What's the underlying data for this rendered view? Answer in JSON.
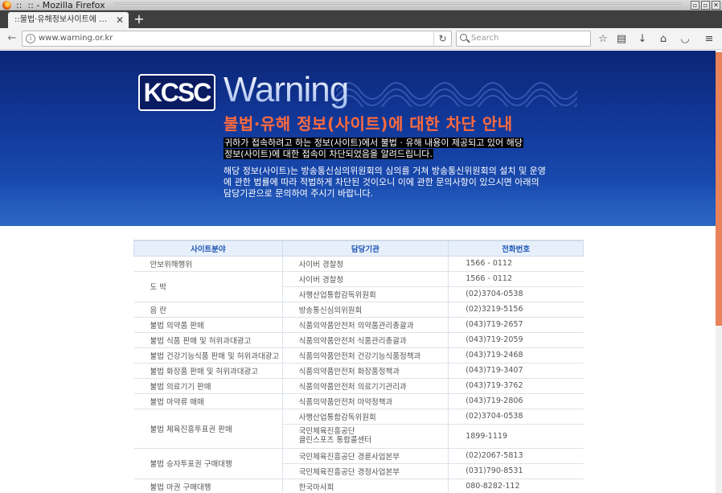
{
  "window": {
    "title": "::  :: - Mozilla Firefox",
    "buttons": [
      "▫",
      "▫",
      "✕"
    ]
  },
  "tab": {
    "title": "::불법·유해정보사이트에 대한…",
    "close": "✕",
    "new_tab": "+"
  },
  "navbar": {
    "back": "←",
    "info": "i",
    "url": "www.warning.or.kr",
    "reload": "↻",
    "search_placeholder": "Search",
    "tools": {
      "bookmark": "☆",
      "reader": "▤",
      "download": "↓",
      "home": "⌂",
      "pocket": "◡",
      "menu": "≡"
    }
  },
  "banner": {
    "logo": "KCSC",
    "wordmark": "Warning",
    "headline": "불법·유해 정보(사이트)에 대한 차단 안내",
    "para1_line1": "귀하가 접속하려고 하는 정보(사이트)에서 불법 · 유해 내용이 제공되고 있어 해당",
    "para1_line2": "정보(사이트)에 대한 접속이 차단되었음을 알려드립니다.",
    "para2": "해당 정보(사이트)는 방송통신심의위원회의 심의를 거쳐 방송통신위원회의 설치 및 운영에 관한 법률에 따라 적법하게 차단된 것이오니 이에 관한 문의사항이 있으시면 아래의 담당기관으로  문의하여 주시기 바랍니다."
  },
  "table": {
    "headers": [
      "사이트분야",
      "담당기관",
      "전화번호"
    ],
    "rows": [
      {
        "field": "안보위해행위",
        "agency": "사이버 경찰청",
        "phone": "1566 - 0112"
      },
      {
        "field": "도 박",
        "agency": "사이버 경찰청",
        "phone": "1566 - 0112"
      },
      {
        "field": "",
        "agency": "사행산업통합감독위원회",
        "phone": "(02)3704-0538"
      },
      {
        "field": "음 란",
        "agency": "방송통신심의위원회",
        "phone": "(02)3219-5156"
      },
      {
        "field": "불법 의약품 판매",
        "agency": "식품의약품안전처 의약품관리총괄과",
        "phone": "(043)719-2657"
      },
      {
        "field": "불법 식품 판매 및 허위과대광고",
        "agency": "식품의약품안전처 식품관리총괄과",
        "phone": "(043)719-2059"
      },
      {
        "field": "불법 건강기능식품 판매 및 허위과대광고",
        "agency": "식품의약품안전처 건강기능식품정책과",
        "phone": "(043)719-2468"
      },
      {
        "field": "불법 화장품 판매 및 허위과대광고",
        "agency": "식품의약품안전처 화장품정책과",
        "phone": "(043)719-3407"
      },
      {
        "field": "불법 의료기기 판매",
        "agency": "식품의약품안전처 의료기기관리과",
        "phone": "(043)719-3762"
      },
      {
        "field": "불법 마약류 매매",
        "agency": "식품의약품안전처 마약정책과",
        "phone": "(043)719-2806"
      },
      {
        "field": "불법 체육진흥투표권 판매",
        "agency": "사행산업통합감독위원회",
        "phone": "(02)3704-0538"
      },
      {
        "field": "",
        "agency_line1": "국민체육진흥공단",
        "agency_line2": "클린스포츠 통합콜센터",
        "phone": "1899-1119"
      },
      {
        "field": "불법 승자투표권 구매대행",
        "agency": "국민체육진흥공단 경륜사업본부",
        "phone": "(02)2067-5813"
      },
      {
        "field": "",
        "agency": "국민체육진흥공단 경정사업본부",
        "phone": "(031)790-8531"
      },
      {
        "field": "불법 마권 구매대행",
        "agency": "한국마사회",
        "phone": "080-8282-112"
      }
    ]
  },
  "colors": {
    "banner_top": "#0b2576",
    "banner_bottom": "#1e56bb",
    "headline": "#ff6a3d",
    "table_header_text": "#1f55b7",
    "scroll_thumb": "#e8825a"
  }
}
